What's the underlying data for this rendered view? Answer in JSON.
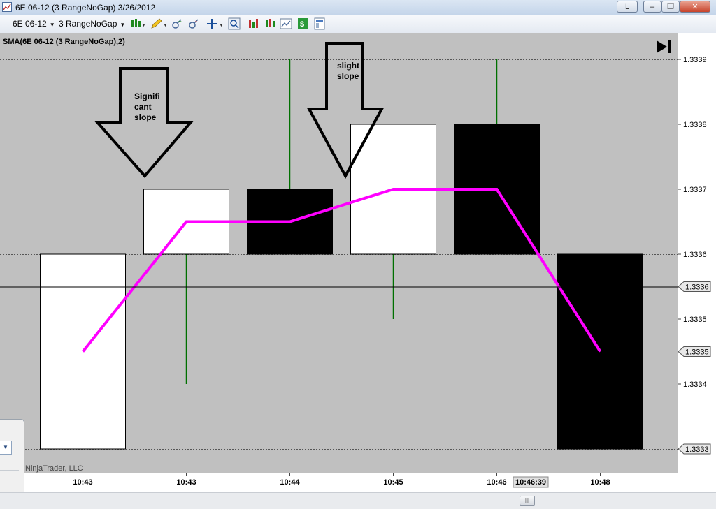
{
  "window": {
    "title": "6E 06-12 (3 RangeNoGap)  3/26/2012",
    "buttons": {
      "link": "L",
      "minimize": "–",
      "restore": "❐",
      "close": "✕"
    }
  },
  "toolbar": {
    "instrument": "6E 06-12",
    "period": "3 RangeNoGap",
    "icons": [
      "chart-style-icon",
      "draw-pencil-icon",
      "zoom-in-icon",
      "zoom-out-icon",
      "crosshair-icon",
      "magnify-icon",
      "indicators-icon",
      "strategies-icon",
      "chart-trader-icon",
      "data-box-icon",
      "properties-icon"
    ]
  },
  "chart_data": {
    "type": "candlestick",
    "indicator_label": "SMA(6E 06-12 (3 RangeNoGap),2)",
    "watermark": "NinjaTrader, LLC",
    "ylim": [
      1.33325,
      1.334
    ],
    "y_ticks": [
      "1.3339",
      "1.3338",
      "1.3337",
      "1.3336",
      "1.3335",
      "1.3334"
    ],
    "y_tick_values": [
      1.3339,
      1.3338,
      1.3337,
      1.3336,
      1.3335,
      1.3334
    ],
    "price_boxes": [
      {
        "label": "1.3336",
        "value": 1.33355
      },
      {
        "label": "1.3335",
        "value": 1.33345
      },
      {
        "label": "1.3333",
        "value": 1.3333
      }
    ],
    "dashed_levels": [
      1.3339,
      1.3336,
      1.3333
    ],
    "categories": [
      "10:43",
      "10:43",
      "10:44",
      "10:45",
      "10:46",
      "10:48"
    ],
    "candles": [
      {
        "open": 1.3333,
        "high": 1.3336,
        "low": 1.3333,
        "close": 1.3336,
        "color": "white"
      },
      {
        "open": 1.3336,
        "high": 1.3337,
        "low": 1.3334,
        "close": 1.3337,
        "color": "white"
      },
      {
        "open": 1.3337,
        "high": 1.3339,
        "low": 1.3336,
        "close": 1.3336,
        "color": "black"
      },
      {
        "open": 1.3336,
        "high": 1.3338,
        "low": 1.3335,
        "close": 1.3338,
        "color": "white"
      },
      {
        "open": 1.3338,
        "high": 1.3339,
        "low": 1.3336,
        "close": 1.3336,
        "color": "black"
      },
      {
        "open": 1.3336,
        "high": 1.3336,
        "low": 1.3333,
        "close": 1.3333,
        "color": "black"
      }
    ],
    "sma": {
      "name": "SMA(6E 06-12 (3 RangeNoGap),2)",
      "values": [
        1.33345,
        1.33365,
        1.33365,
        1.3337,
        1.3337,
        1.33345
      ],
      "color": "#ff00ff"
    },
    "crosshair": {
      "time_label": "10:46:39",
      "price": 1.33355
    },
    "annotations": [
      {
        "text_lines": [
          "Signifi",
          "cant",
          "slope"
        ],
        "candle_index": 1
      },
      {
        "text_lines": [
          "slight",
          "slope"
        ],
        "candle_index": 3
      }
    ]
  },
  "colors": {
    "chart_bg": "#c0c0c0",
    "wick": "#007000",
    "sma": "#ff00ff",
    "axis_bg": "#ffffff"
  }
}
